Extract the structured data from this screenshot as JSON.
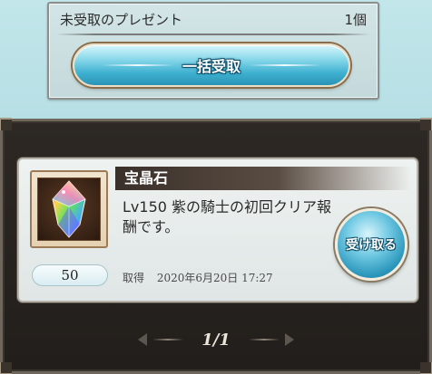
{
  "unreceived": {
    "label": "未受取のプレゼント",
    "count": "1個",
    "bulk_button_label": "一括受取"
  },
  "present": {
    "name": "宝晶石",
    "description": "Lv150 紫の騎士の初回クリア報酬です。",
    "quantity": "50",
    "acquired_label": "取得",
    "acquired_date": "2020年6月20日 17:27",
    "receive_button_label": "受け取る",
    "item_icon": "crystal-icon"
  },
  "pager": {
    "text": "1/1"
  },
  "colors": {
    "background": "#b3dde3",
    "panel_dark": "#2d2824",
    "button_blue": "#3eb0d0",
    "card_bg": "#eef2f1"
  }
}
